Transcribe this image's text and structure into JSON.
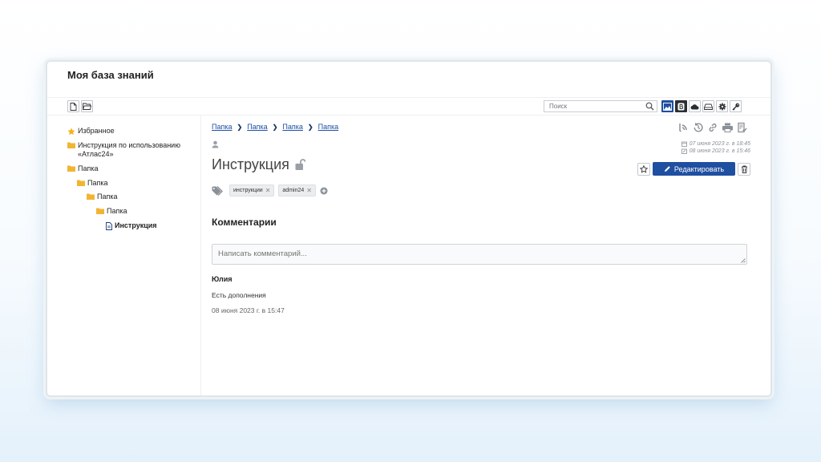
{
  "app": {
    "title": "Моя база знаний"
  },
  "toolbar": {
    "left_icons": [
      "new-document-icon",
      "open-folder-icon"
    ],
    "search_placeholder": "Поиск",
    "right_icons": [
      "image-icon",
      "b-letter-icon",
      "cloud-icon",
      "drive-icon",
      "gear-icon",
      "key-icon"
    ]
  },
  "sidebar": {
    "items": [
      {
        "label": "Избранное",
        "icon": "star-icon"
      },
      {
        "label": "Инструкция по использованию «Атлас24»",
        "icon": "folder-icon"
      },
      {
        "label": "Папка",
        "icon": "folder-icon"
      },
      {
        "label": "Папка",
        "icon": "folder-icon"
      },
      {
        "label": "Папка",
        "icon": "folder-icon"
      },
      {
        "label": "Папка",
        "icon": "folder-icon"
      },
      {
        "label": "Инструкция",
        "icon": "document-icon",
        "active": true
      }
    ]
  },
  "breadcrumb": [
    "Папка",
    "Папка",
    "Папка",
    "Папка"
  ],
  "document": {
    "title": "Инструкция",
    "lock_icon": "unlock-icon",
    "created": "07 июня 2023 г. в 18:45",
    "modified": "08 июня 2023 г. в 15:46",
    "tags": [
      "инструкции",
      "admin24"
    ],
    "actions_icons": [
      "rss-icon",
      "history-icon",
      "link-icon",
      "print-icon",
      "checklist-icon"
    ],
    "edit_label": "Редактировать"
  },
  "comments": {
    "title": "Комментарии",
    "placeholder": "Написать комментарий...",
    "items": [
      {
        "author": "Юлия",
        "text": "Есть дополнения",
        "date": "08 июня 2023 г. в 15:47"
      }
    ]
  },
  "colors": {
    "accent": "#1f4fa0",
    "link": "#1a4ea3",
    "folder": "#f2b532",
    "star": "#f5b21b"
  }
}
